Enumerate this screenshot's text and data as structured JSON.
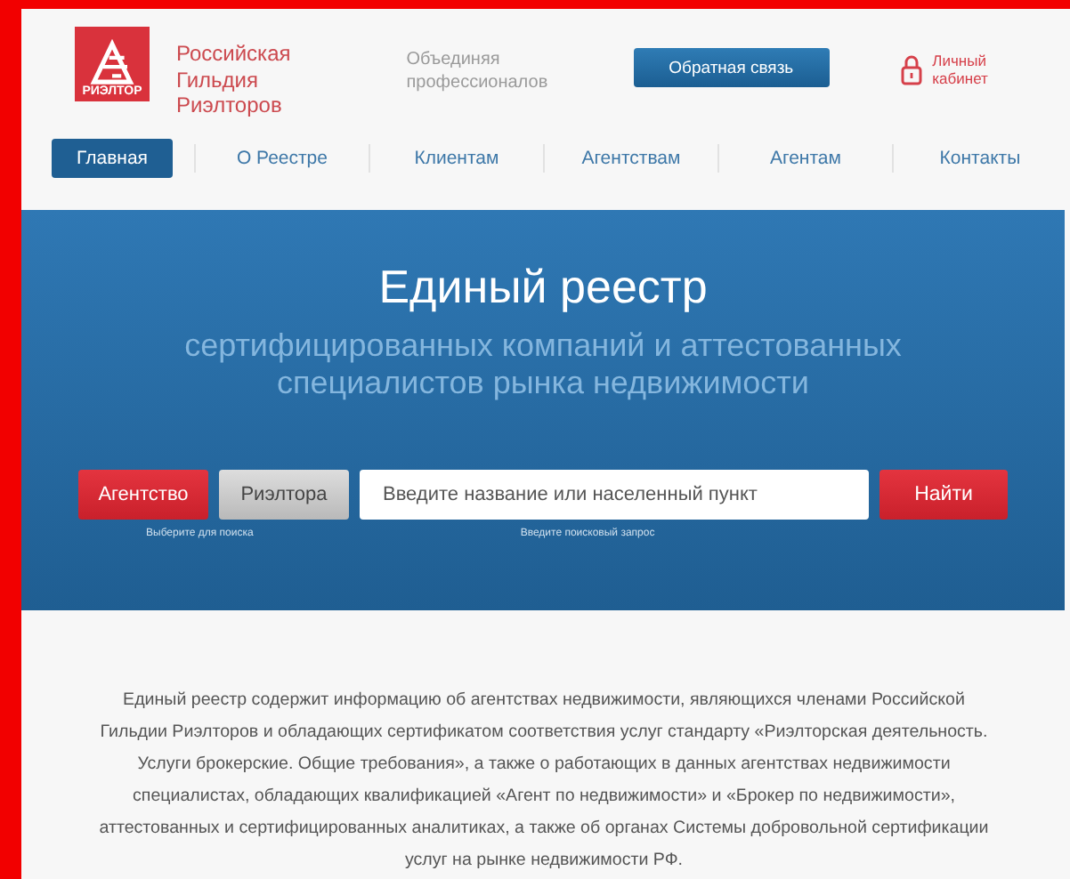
{
  "logo": {
    "mark": "РИЭЛТОР",
    "name_lines": [
      "Российская",
      "Гильдия",
      "Риэлторов"
    ]
  },
  "tagline_lines": [
    "Объединяя",
    "профессионалов"
  ],
  "feedback_button": "Обратная связь",
  "account_link_lines": [
    "Личный",
    "кабинет"
  ],
  "nav": [
    {
      "label": "Главная",
      "selected": true
    },
    {
      "label": "О Реестре",
      "selected": false
    },
    {
      "label": "Клиентам",
      "selected": false
    },
    {
      "label": "Агентствам",
      "selected": false
    },
    {
      "label": "Агентам",
      "selected": false
    },
    {
      "label": "Контакты",
      "selected": false
    }
  ],
  "hero": {
    "title": "Единый реестр",
    "subtitle_lines": [
      "сертифицированных компаний и аттестованных",
      "специалистов рынка недвижимости"
    ]
  },
  "search": {
    "types": [
      {
        "label": "Агентство",
        "selected": true
      },
      {
        "label": "Риэлтора",
        "selected": false
      }
    ],
    "type_hint": "Выберите для поиска",
    "placeholder": "Введите название или населенный пункт",
    "query_hint": "Введите поисковый запрос",
    "button": "Найти"
  },
  "description": "Единый реестр содержит информацию об агентствах недвижимости, являющихся членами Российской Гильдии Риэлторов и обладающих сертификатом соответствия услуг стандарту «Риэлторская деятельность. Услуги брокерские. Общие требования», а также о работающих в данных агентствах недвижимости специалистах, обладающих квалификацией «Агент по недвижимости» и «Брокер по недвижимости», аттестованных и сертифицированных аналитиках, а также об органах Системы добровольной сертификации услуг на рынке недвижимости РФ."
}
